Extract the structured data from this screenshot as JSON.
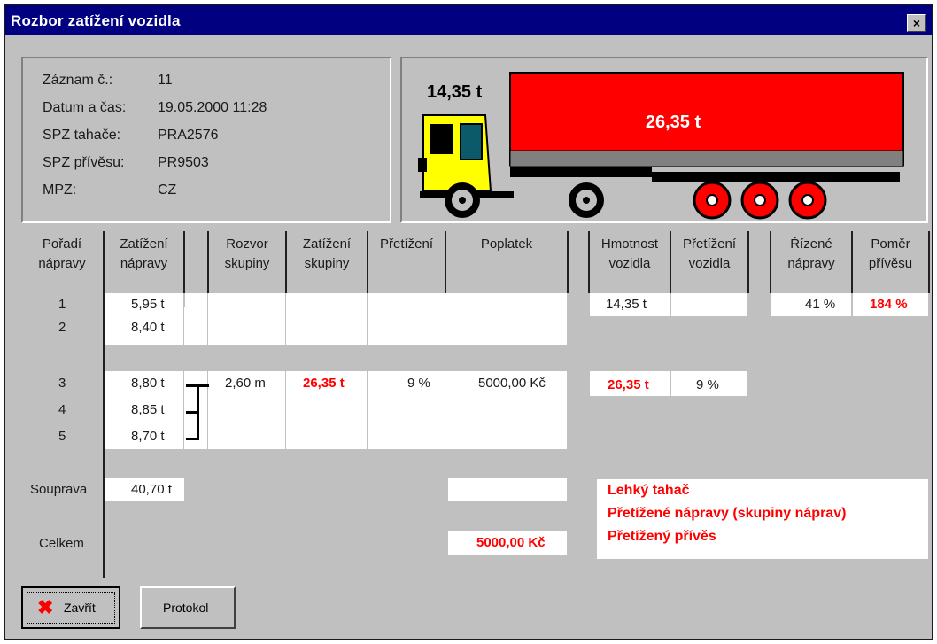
{
  "window": {
    "title": "Rozbor zatížení vozidla",
    "close_glyph": "×"
  },
  "record": {
    "labels": {
      "record_no": "Záznam č.:",
      "datetime": "Datum a čas:",
      "spz_tractor": "SPZ tahače:",
      "spz_trailer": "SPZ přívěsu:",
      "mpz": "MPZ:"
    },
    "values": {
      "record_no": "11",
      "datetime": "19.05.2000  11:28",
      "spz_tractor": "PRA2576",
      "spz_trailer": "PR9503",
      "mpz": "CZ"
    }
  },
  "truck": {
    "tractor_weight": "14,35 t",
    "trailer_weight": "26,35 t",
    "colors": {
      "trailer": "#ff0000",
      "cab": "#ffff00",
      "wheel_trailer": "#ff0000"
    }
  },
  "table": {
    "headers": {
      "axle_order": [
        "Pořadí",
        "nápravy"
      ],
      "axle_load": [
        "Zatížení",
        "nápravy"
      ],
      "wheelbase": [
        "Rozvor",
        "skupiny"
      ],
      "group_load": [
        "Zatížení",
        "skupiny"
      ],
      "overload": [
        "Přetížení"
      ],
      "fee": [
        "Poplatek"
      ],
      "vehicle_weight": [
        "Hmotnost",
        "vozidla"
      ],
      "vehicle_overload": [
        "Přetížení",
        "vozidla"
      ],
      "steered": [
        "Řízené",
        "nápravy"
      ],
      "trailer_ratio": [
        "Poměr",
        "přívěsu"
      ]
    },
    "axles": [
      {
        "no": "1",
        "load": "5,95 t"
      },
      {
        "no": "2",
        "load": "8,40 t"
      },
      {
        "no": "3",
        "load": "8,80 t"
      },
      {
        "no": "4",
        "load": "8,85 t"
      },
      {
        "no": "5",
        "load": "8,70 t"
      }
    ],
    "tractor_row": {
      "weight": "14,35 t",
      "steered": "41 %",
      "ratio": "184 %"
    },
    "group_row": {
      "wheelbase": "2,60 m",
      "group_load": "26,35 t",
      "overload": "9 %",
      "fee": "5000,00 Kč",
      "vehicle_weight": "26,35 t",
      "vehicle_overload": "9 %"
    },
    "combo": {
      "label": "Souprava",
      "load": "40,70 t",
      "fee": ""
    },
    "total": {
      "label": "Celkem",
      "fee": "5000,00 Kč"
    },
    "warnings": [
      "Lehký tahač",
      "Přetížené nápravy (skupiny náprav)",
      "Přetížený přívěs"
    ]
  },
  "buttons": {
    "close": "Zavřít",
    "protocol": "Protokol"
  },
  "icons": {
    "close_x": "red-x-icon"
  }
}
